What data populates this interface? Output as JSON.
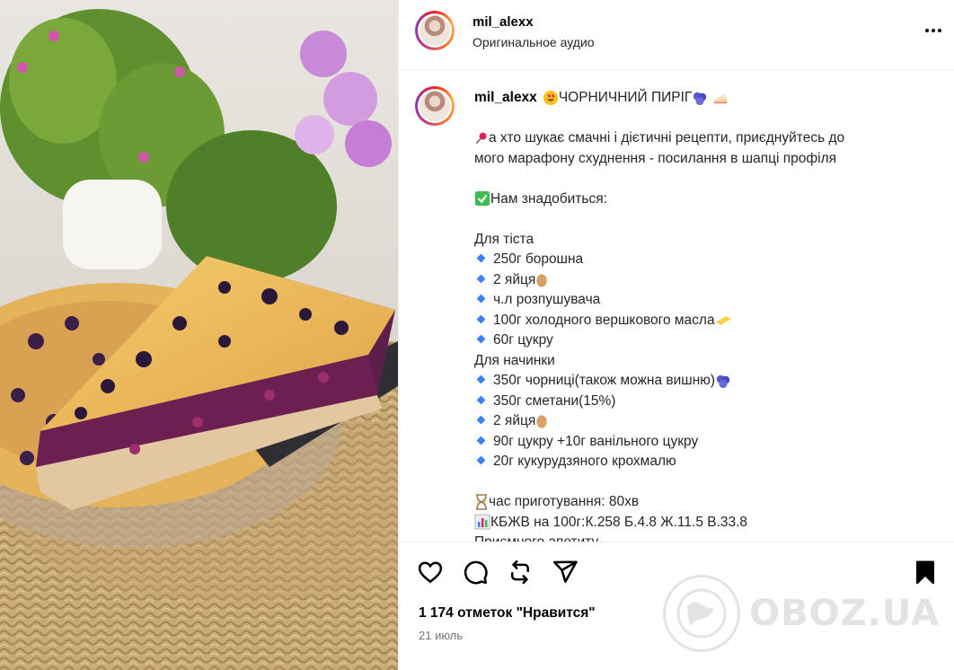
{
  "header": {
    "username": "mil_alexx",
    "audio": "Оригинальное аудио",
    "more_icon": "more-horizontal-icon"
  },
  "caption": {
    "username": "mil_alexx",
    "lines": [
      {
        "type": "title",
        "text": "ЧОРНИЧНИЙ ПИРІГ"
      },
      {
        "type": "blank",
        "text": ""
      },
      {
        "type": "pin",
        "text": "а хто шукає смачні і дієтичні рецепти, приєднуйтесь до"
      },
      {
        "type": "plain",
        "text": "мого марафону схуднення - посилання в шапці профіля"
      },
      {
        "type": "blank",
        "text": ""
      },
      {
        "type": "check",
        "text": "Нам знадобиться:"
      },
      {
        "type": "blank",
        "text": ""
      },
      {
        "type": "plain",
        "text": "Для тіста"
      },
      {
        "type": "item",
        "text": "250г борошна"
      },
      {
        "type": "item-egg",
        "text": "2 яйця"
      },
      {
        "type": "item",
        "text": "ч.л розпушувача"
      },
      {
        "type": "item-butter",
        "text": "100г холодного вершкового масла"
      },
      {
        "type": "item",
        "text": "60г цукру"
      },
      {
        "type": "plain",
        "text": "Для начинки"
      },
      {
        "type": "item-berry",
        "text": "350г чорниці(також можна вишню)"
      },
      {
        "type": "item",
        "text": "350г сметани(15%)"
      },
      {
        "type": "item-egg",
        "text": "2 яйця"
      },
      {
        "type": "item",
        "text": "90г цукру +10г ванільного цукру"
      },
      {
        "type": "item",
        "text": "20г кукурудзяного крохмалю"
      },
      {
        "type": "blank",
        "text": ""
      },
      {
        "type": "hourglass",
        "text": "час приготування: 80хв"
      },
      {
        "type": "chart",
        "text": "КБЖВ на 100г:К.258 Б.4.8 Ж.11.5 В.33.8"
      },
      {
        "type": "cut",
        "text": "Приємного апетиту"
      }
    ]
  },
  "actions": {
    "like_icon": "heart-icon",
    "comment_icon": "comment-icon",
    "repost_icon": "repost-icon",
    "share_icon": "send-icon",
    "save_icon": "bookmark-icon"
  },
  "likes": "1 174 отметок \"Нравится\"",
  "date": "21 июль",
  "watermark": "OBOZ.UA"
}
